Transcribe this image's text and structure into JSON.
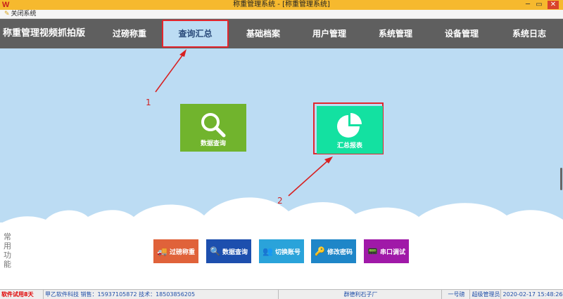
{
  "window": {
    "title": "称重管理系统 - [称重管理系统]",
    "logo": "W",
    "minimize": "─",
    "maximize": "▭",
    "close": "✕"
  },
  "menu": {
    "close_system": "关闭系统"
  },
  "nav": {
    "brand": "称重管理视频抓拍版",
    "items": [
      "过磅称重",
      "查询汇总",
      "基础档案",
      "用户管理",
      "系统管理",
      "设备管理",
      "系统日志"
    ],
    "active_index": 1
  },
  "tiles": [
    {
      "label": "数据查询",
      "icon": "search-icon",
      "color": "#71b42d"
    },
    {
      "label": "汇总报表",
      "icon": "pie-chart-icon",
      "color": "#13e1a1"
    }
  ],
  "annotations": [
    "1",
    "2"
  ],
  "common": {
    "label": "常用功能",
    "buttons": [
      {
        "label": "过磅称重",
        "icon": "truck-icon",
        "color": "#e0623a"
      },
      {
        "label": "数据查询",
        "icon": "search-icon",
        "color": "#1d4fae"
      },
      {
        "label": "切换账号",
        "icon": "users-icon",
        "color": "#2aa3da"
      },
      {
        "label": "修改密码",
        "icon": "key-icon",
        "color": "#1e86c8"
      },
      {
        "label": "串口调试",
        "icon": "device-icon",
        "color": "#a019a8"
      }
    ]
  },
  "status": {
    "trial": "软件试用8天",
    "company": "甲乙软件科技  销售：15937105872  技术：18503856205",
    "customer": "群德利石子厂",
    "scale": "一号磅",
    "role": "超级管理员",
    "datetime": "2020-02-17  15:48:26"
  }
}
